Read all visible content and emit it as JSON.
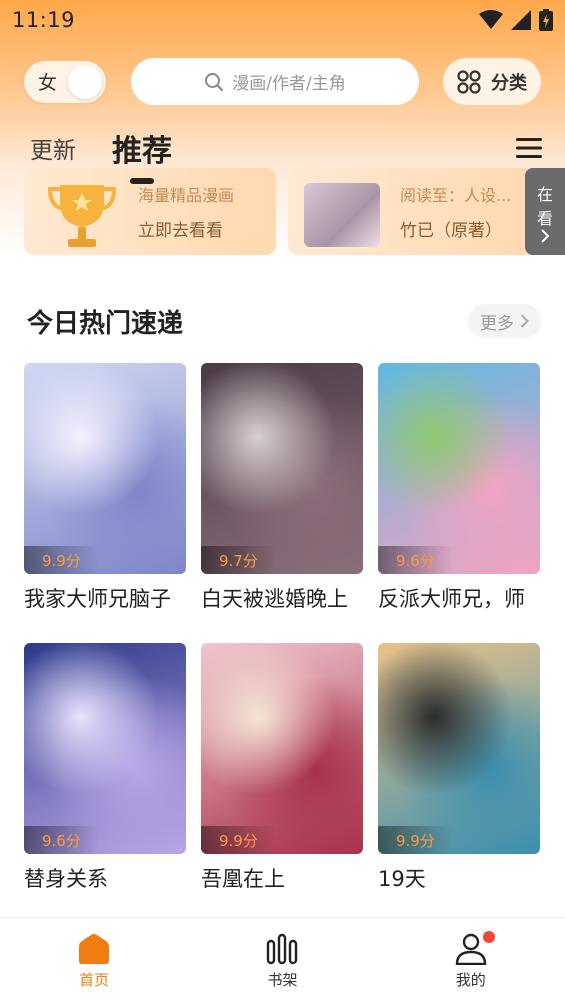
{
  "status_bar": {
    "time": "11:19"
  },
  "header": {
    "gender_label": "女",
    "search_placeholder": "漫画/作者/主角",
    "category_label": "分类"
  },
  "tabs": [
    {
      "label": "更新",
      "active": false
    },
    {
      "label": "推荐",
      "active": true
    }
  ],
  "banners": [
    {
      "subtitle": "海量精品漫画",
      "link": "立即去看看"
    },
    {
      "subtitle": "阅读至：人设...",
      "link": "竹已（原著）"
    }
  ],
  "read_more_tab": {
    "line1": "在",
    "line2": "看"
  },
  "section": {
    "title": "今日热门速递",
    "more_label": "更多"
  },
  "comics": [
    {
      "title": "我家大师兄脑子",
      "score": "9.9分",
      "palette": [
        "#cfd8f2",
        "#7e86c8",
        "#f4f0ff"
      ]
    },
    {
      "title": "白天被逃婚晚上",
      "score": "9.7分",
      "palette": [
        "#4a3a45",
        "#8c6f7c",
        "#d8cfd2"
      ]
    },
    {
      "title": "反派大师兄，师",
      "score": "9.6分",
      "palette": [
        "#5fb8e0",
        "#f2a3c2",
        "#8fc970"
      ]
    },
    {
      "title": "替身关系",
      "score": "9.6分",
      "palette": [
        "#2c3a8a",
        "#b9a6e6",
        "#e8e2ff"
      ]
    },
    {
      "title": "吾凰在上",
      "score": "9.9分",
      "palette": [
        "#f0c6cf",
        "#a8304a",
        "#f6e5d4"
      ]
    },
    {
      "title": "19天",
      "score": "9.9分",
      "palette": [
        "#e8c28a",
        "#3c8fae",
        "#2c2c2c"
      ]
    }
  ],
  "bottom_nav": [
    {
      "label": "首页",
      "active": true
    },
    {
      "label": "书架",
      "active": false
    },
    {
      "label": "我的",
      "active": false,
      "badge": true
    }
  ],
  "colors": {
    "accent": "#f07c12",
    "score": "#ff9a3c",
    "badge": "#f5443a"
  }
}
